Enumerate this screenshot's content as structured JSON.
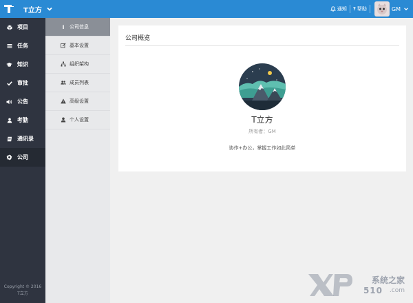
{
  "header": {
    "brand": "T立方",
    "notify": "通知",
    "help": "帮助",
    "user": "GM"
  },
  "nav": {
    "items": [
      {
        "label": "项目",
        "icon": "cube-icon"
      },
      {
        "label": "任务",
        "icon": "list-icon"
      },
      {
        "label": "知识",
        "icon": "graduation-cap-icon"
      },
      {
        "label": "审批",
        "icon": "check-icon"
      },
      {
        "label": "公告",
        "icon": "volume-icon"
      },
      {
        "label": "考勤",
        "icon": "user-icon"
      },
      {
        "label": "通讯录",
        "icon": "book-icon"
      },
      {
        "label": "公司",
        "icon": "gear-icon"
      }
    ],
    "active_index": 7,
    "copyright_line1": "Copyright © 2016",
    "copyright_line2": "T立方"
  },
  "subnav": {
    "items": [
      {
        "label": "公司信息",
        "icon": "info-icon"
      },
      {
        "label": "基本设置",
        "icon": "edit-icon"
      },
      {
        "label": "组织架构",
        "icon": "sitemap-icon"
      },
      {
        "label": "成员列表",
        "icon": "users-icon"
      },
      {
        "label": "高级设置",
        "icon": "warning-icon"
      },
      {
        "label": "个人设置",
        "icon": "person-icon"
      }
    ],
    "active_index": 0
  },
  "content": {
    "panel_title": "公司概览",
    "company_name": "T立方",
    "owner": "所有者：GM",
    "slogan": "协作+办公，掌握工作如此简单"
  },
  "watermark": {
    "text": "系统之家",
    "number": "510",
    "com": ".com"
  },
  "colors": {
    "topbar": "#2a8ad4",
    "leftnav": "#2f3440",
    "subnav": "#e8e9eb",
    "active_sub": "#8a8f97"
  }
}
